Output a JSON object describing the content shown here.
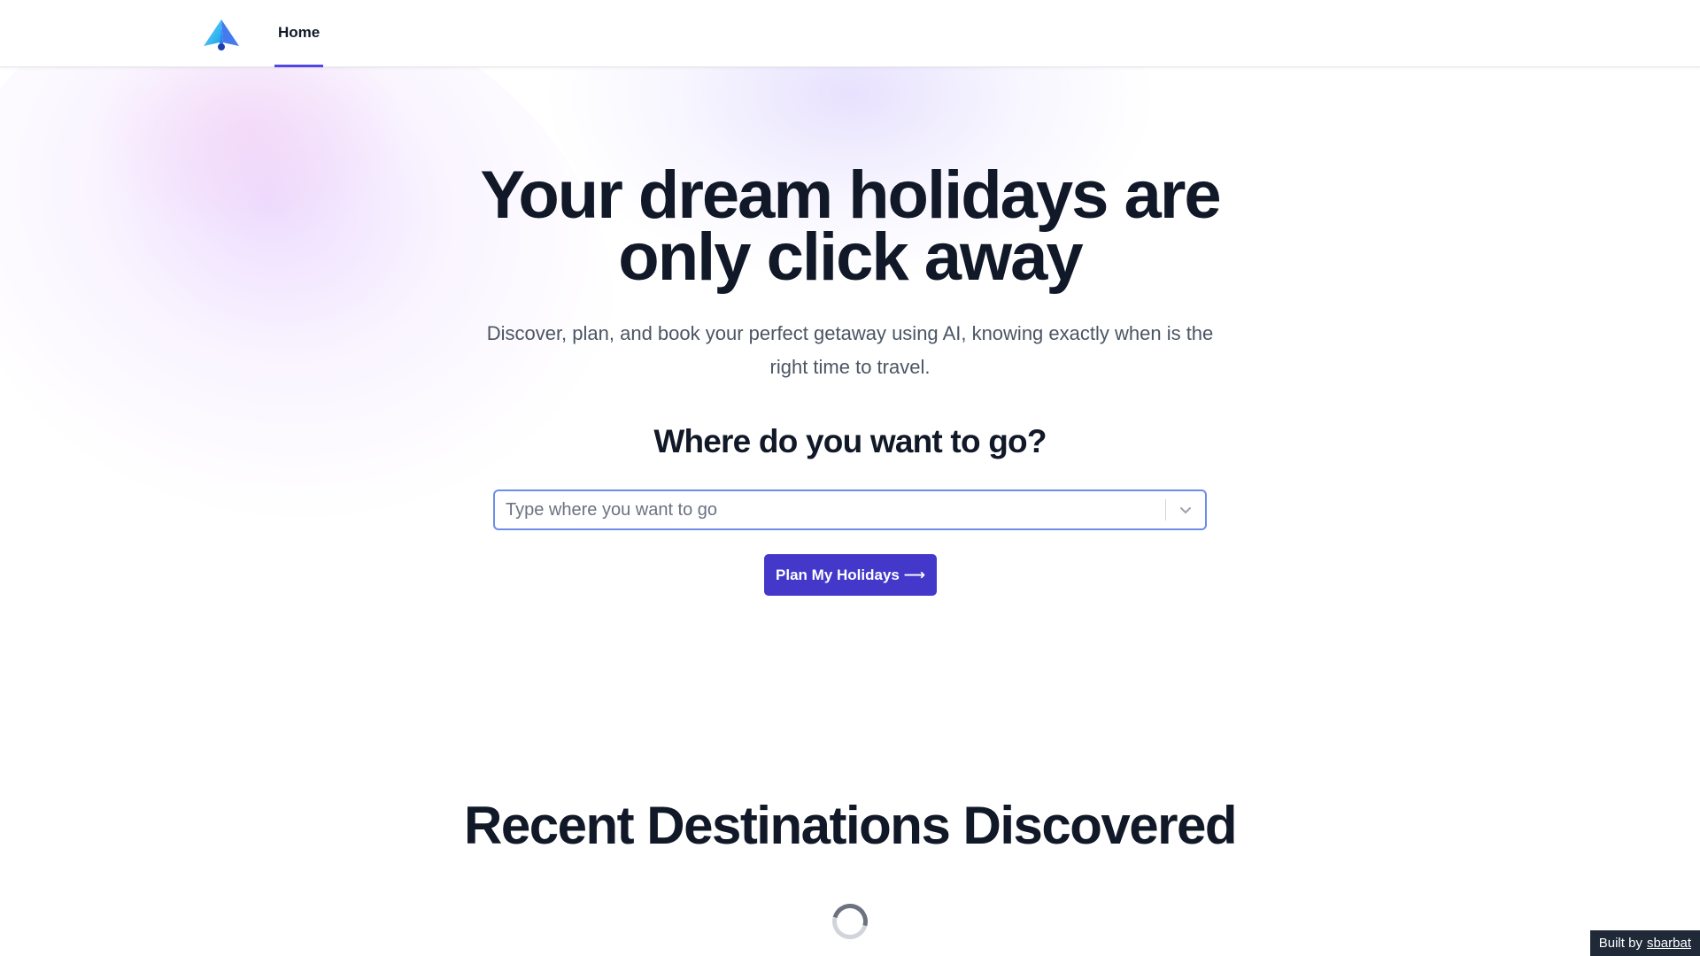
{
  "nav": {
    "logo_icon": "paper-plane-logo-icon",
    "items": [
      {
        "label": "Home",
        "active": true
      }
    ],
    "accent": "#4f46e5"
  },
  "hero": {
    "title": "Your dream holidays are only click away",
    "subtitle": "Discover, plan, and book your perfect getaway using AI, knowing exactly when is the right time to travel."
  },
  "search": {
    "heading": "Where do you want to go?",
    "value": "",
    "placeholder": "Type where you want to go",
    "dropdown_icon": "chevron-down-icon"
  },
  "cta": {
    "label": "Plan My Holidays ⟶",
    "color": "#4338ca"
  },
  "recent": {
    "title": "Recent Destinations Discovered",
    "loading_icon": "loading-spinner-icon"
  },
  "footer": {
    "built_by_label": "Built by",
    "author": "sbarbat"
  }
}
